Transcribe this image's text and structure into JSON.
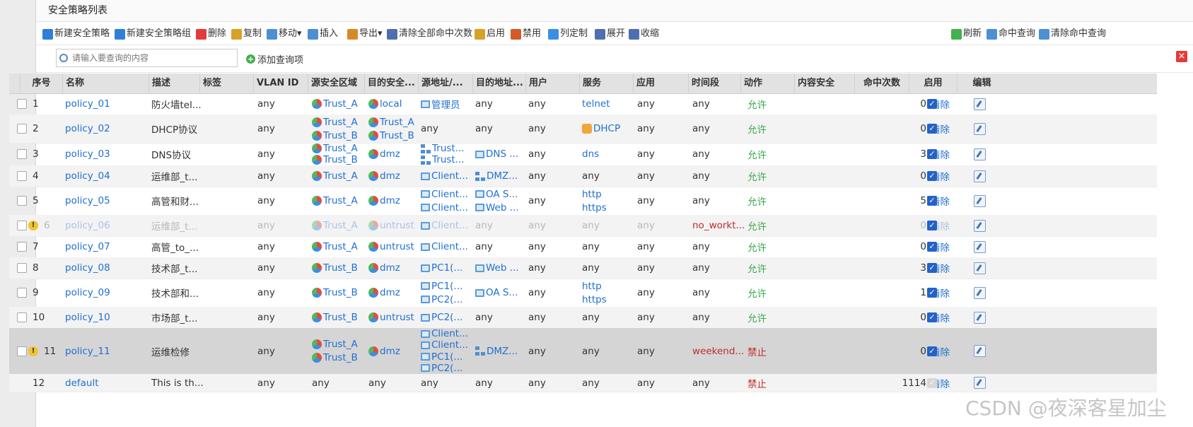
{
  "title": "安全策略列表",
  "toolbar": {
    "left": [
      "新建安全策略",
      "新建安全策略组",
      "删除",
      "复制",
      "移动▾",
      "插入",
      "导出▾",
      "清除全部命中次数",
      "启用",
      "禁用",
      "列定制",
      "展开",
      "收缩"
    ],
    "right": [
      "刷新",
      "命中查询",
      "清除命中查询"
    ]
  },
  "search": {
    "placeholder": "请输入要查询的内容",
    "add_label": "添加查询项"
  },
  "columns": [
    "序号",
    "名称",
    "描述",
    "标签",
    "VLAN ID",
    "源安全区域",
    "目的安全...",
    "源地址/...",
    "目的地址...",
    "用户",
    "服务",
    "应用",
    "时间段",
    "动作",
    "内容安全",
    "命中次数",
    "启用",
    "编辑"
  ],
  "clear_label": "清除",
  "rows": [
    {
      "seq": "1",
      "name": "policy_01",
      "desc": "防火墙tel...",
      "vlan": "any",
      "src_zone": [
        "Trust_A"
      ],
      "dst_zone": [
        "local"
      ],
      "src_addr": [
        {
          "i": "host",
          "t": "管理员"
        }
      ],
      "dst_addr": [
        {
          "i": "",
          "t": "any"
        }
      ],
      "user": "any",
      "service": [
        {
          "i": "",
          "t": "telnet"
        }
      ],
      "app": "any",
      "time": "any",
      "action": "允许",
      "hits": "0",
      "enabled": true
    },
    {
      "seq": "2",
      "name": "policy_02",
      "desc": "DHCP协议",
      "vlan": "any",
      "src_zone": [
        "Trust_A",
        "Trust_B"
      ],
      "dst_zone": [
        "Trust_A",
        "Trust_B"
      ],
      "src_addr": [
        {
          "i": "",
          "t": "any"
        }
      ],
      "dst_addr": [
        {
          "i": "",
          "t": "any"
        }
      ],
      "user": "any",
      "service": [
        {
          "i": "svc",
          "t": "DHCP"
        }
      ],
      "app": "any",
      "time": "any",
      "action": "允许",
      "hits": "0",
      "enabled": true
    },
    {
      "seq": "3",
      "name": "policy_03",
      "desc": "DNS协议",
      "vlan": "any",
      "src_zone": [
        "Trust_A",
        "Trust_B"
      ],
      "dst_zone": [
        "dmz"
      ],
      "src_addr": [
        {
          "i": "net",
          "t": "Trust..."
        },
        {
          "i": "net",
          "t": "Trust..."
        }
      ],
      "dst_addr": [
        {
          "i": "host",
          "t": "DNS ..."
        }
      ],
      "user": "any",
      "service": [
        {
          "i": "",
          "t": "dns"
        }
      ],
      "app": "any",
      "time": "any",
      "action": "允许",
      "hits": "3",
      "enabled": true
    },
    {
      "seq": "4",
      "name": "policy_04",
      "desc": "运维部_t...",
      "vlan": "any",
      "src_zone": [
        "Trust_A"
      ],
      "dst_zone": [
        "dmz"
      ],
      "src_addr": [
        {
          "i": "host",
          "t": "Client..."
        }
      ],
      "dst_addr": [
        {
          "i": "net",
          "t": "DMZ..."
        }
      ],
      "user": "any",
      "service": [
        {
          "i": "",
          "t": "any"
        }
      ],
      "app": "any",
      "time": "any",
      "action": "允许",
      "hits": "0",
      "enabled": true
    },
    {
      "seq": "5",
      "name": "policy_05",
      "desc": "高管和财...",
      "vlan": "any",
      "src_zone": [
        "Trust_A"
      ],
      "dst_zone": [
        "dmz"
      ],
      "src_addr": [
        {
          "i": "host",
          "t": "Client..."
        },
        {
          "i": "host",
          "t": "Client..."
        }
      ],
      "dst_addr": [
        {
          "i": "host",
          "t": "OA S..."
        },
        {
          "i": "host",
          "t": "Web ..."
        }
      ],
      "user": "any",
      "service": [
        {
          "i": "",
          "t": "http"
        },
        {
          "i": "",
          "t": "https"
        }
      ],
      "app": "any",
      "time": "any",
      "action": "允许",
      "hits": "5",
      "enabled": true
    },
    {
      "seq": "6",
      "name": "policy_06",
      "desc": "运维部_t...",
      "vlan": "any",
      "src_zone": [
        "Trust_A"
      ],
      "dst_zone": [
        "untrust"
      ],
      "src_addr": [
        {
          "i": "host",
          "t": "Client..."
        }
      ],
      "dst_addr": [
        {
          "i": "",
          "t": "any"
        }
      ],
      "user": "any",
      "service": [
        {
          "i": "",
          "t": "any"
        }
      ],
      "app": "any",
      "time": "no_workt...",
      "action": "允许",
      "hits": "0",
      "enabled": true,
      "disabled_style": true,
      "warn": true
    },
    {
      "seq": "7",
      "name": "policy_07",
      "desc": "高管_to_...",
      "vlan": "any",
      "src_zone": [
        "Trust_A"
      ],
      "dst_zone": [
        "untrust"
      ],
      "src_addr": [
        {
          "i": "host",
          "t": "Client..."
        }
      ],
      "dst_addr": [
        {
          "i": "",
          "t": "any"
        }
      ],
      "user": "any",
      "service": [
        {
          "i": "",
          "t": "any"
        }
      ],
      "app": "any",
      "time": "any",
      "action": "允许",
      "hits": "0",
      "enabled": true
    },
    {
      "seq": "8",
      "name": "policy_08",
      "desc": "技术部_t...",
      "vlan": "any",
      "src_zone": [
        "Trust_B"
      ],
      "dst_zone": [
        "dmz"
      ],
      "src_addr": [
        {
          "i": "host",
          "t": "PC1(..."
        }
      ],
      "dst_addr": [
        {
          "i": "host",
          "t": "Web ..."
        }
      ],
      "user": "any",
      "service": [
        {
          "i": "",
          "t": "any"
        }
      ],
      "app": "any",
      "time": "any",
      "action": "允许",
      "hits": "3",
      "enabled": true
    },
    {
      "seq": "9",
      "name": "policy_09",
      "desc": "技术部和...",
      "vlan": "any",
      "src_zone": [
        "Trust_B"
      ],
      "dst_zone": [
        "dmz"
      ],
      "src_addr": [
        {
          "i": "host",
          "t": "PC1(..."
        },
        {
          "i": "host",
          "t": "PC2(..."
        }
      ],
      "dst_addr": [
        {
          "i": "host",
          "t": "OA S..."
        }
      ],
      "user": "any",
      "service": [
        {
          "i": "",
          "t": "http"
        },
        {
          "i": "",
          "t": "https"
        }
      ],
      "app": "any",
      "time": "any",
      "action": "允许",
      "hits": "1",
      "enabled": true
    },
    {
      "seq": "10",
      "name": "policy_10",
      "desc": "市场部_t...",
      "vlan": "any",
      "src_zone": [
        "Trust_B"
      ],
      "dst_zone": [
        "untrust"
      ],
      "src_addr": [
        {
          "i": "host",
          "t": "PC2(..."
        }
      ],
      "dst_addr": [
        {
          "i": "",
          "t": "any"
        }
      ],
      "user": "any",
      "service": [
        {
          "i": "",
          "t": "any"
        }
      ],
      "app": "any",
      "time": "any",
      "action": "允许",
      "hits": "0",
      "enabled": true
    },
    {
      "seq": "11",
      "name": "policy_11",
      "desc": "运维检修",
      "vlan": "any",
      "src_zone": [
        "Trust_A",
        "Trust_B"
      ],
      "dst_zone": [
        "dmz"
      ],
      "src_addr": [
        {
          "i": "host",
          "t": "Client..."
        },
        {
          "i": "host",
          "t": "Client..."
        },
        {
          "i": "host",
          "t": "PC1(..."
        },
        {
          "i": "host",
          "t": "PC2(..."
        }
      ],
      "dst_addr": [
        {
          "i": "net",
          "t": "DMZ..."
        }
      ],
      "user": "any",
      "service": [
        {
          "i": "",
          "t": "any"
        }
      ],
      "app": "any",
      "time": "weekend...",
      "action": "禁止",
      "hits": "0",
      "enabled": true,
      "selected": true,
      "warn": true
    },
    {
      "seq": "12",
      "name": "default",
      "desc": "This is th...",
      "vlan": "any",
      "src_zone_text": "any",
      "dst_zone_text": "any",
      "src_addr": [
        {
          "i": "",
          "t": "any"
        }
      ],
      "dst_addr": [
        {
          "i": "",
          "t": "any"
        }
      ],
      "user": "any",
      "service": [
        {
          "i": "",
          "t": "any"
        }
      ],
      "app": "any",
      "time": "any",
      "action": "禁止",
      "hits": "1114",
      "enabled": false,
      "no_checkbox": true
    }
  ],
  "colors": {
    "accent": "#1f6fd1",
    "allow": "#3aa84a",
    "deny": "#c22a2a",
    "header_bg": "#e2e2e2"
  },
  "watermark": "CSDN @夜深客星加尘"
}
